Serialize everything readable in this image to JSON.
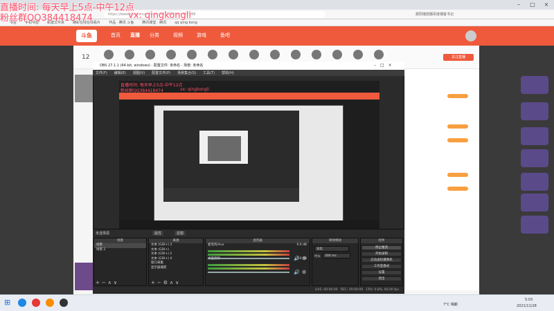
{
  "overlay": {
    "line1": "直播时间: 每天早上5点-中午12点",
    "line2_left": "粉丝群QQ384418474",
    "line2_right": "vx: qingkongli"
  },
  "browser": {
    "url": "https://www.douyu.com/topic/537366?rid=537366",
    "bookmarks": [
      "书签",
      "手机书签",
      "新建文件夹",
      "精彩在线在线看片",
      "作品 · 腾讯 斗鱼",
      "腾讯课堂 · 腾讯",
      "qq qing kong"
    ],
    "right_ext": "晨阳播放器百度播客书记"
  },
  "site": {
    "logo": "斗鱼",
    "nav": [
      "首页",
      "直播",
      "分类",
      "视频",
      "游戏",
      "鱼吧"
    ],
    "fans_count": "12",
    "chat_top_btn": "关注直播"
  },
  "obs": {
    "title": "OBS 27.1.1 (64-bit, windows) - 配置文件: 未命名 - 场景: 未命名",
    "menu": [
      "文件(F)",
      "编辑(E)",
      "视图(V)",
      "配置文件(P)",
      "场景集合(S)",
      "工具(T)",
      "帮助(H)"
    ],
    "no_source": "未选择源",
    "props_btn": "属性",
    "filter_btn": "滤镜",
    "docks": {
      "scenes": "场景",
      "sources": "来源",
      "mixer": "混音器",
      "transitions": "转场特效",
      "controls": "控件"
    },
    "scenes": [
      "场景",
      "场景 2"
    ],
    "sources": [
      "文本 (GDI+) 3",
      "文本 (GDI+)",
      "文本 (GDI+) 2",
      "文本 (GDI+) 4",
      "窗口采集",
      "显示器捕获"
    ],
    "mixer_channels": [
      {
        "name": "麦克风/Aux",
        "db": "0.0 dB"
      },
      {
        "name": "桌面音频",
        "db": "0.0 dB"
      }
    ],
    "transition": {
      "type": "淡化",
      "duration_label": "时长",
      "duration": "300 ms"
    },
    "controls": [
      "停止推流",
      "开始录制",
      "启动虚拟摄像机",
      "工作室模式",
      "设置",
      "退出"
    ],
    "status": {
      "live": "LIVE: 00:00:00",
      "rec": "REC: 00:00:00",
      "cpu": "CPU: 0.8%, 60.00 fps"
    }
  },
  "taskbar": {
    "weather": "7°C 晴朗",
    "time": "5:03",
    "date": "2021/11/28"
  }
}
